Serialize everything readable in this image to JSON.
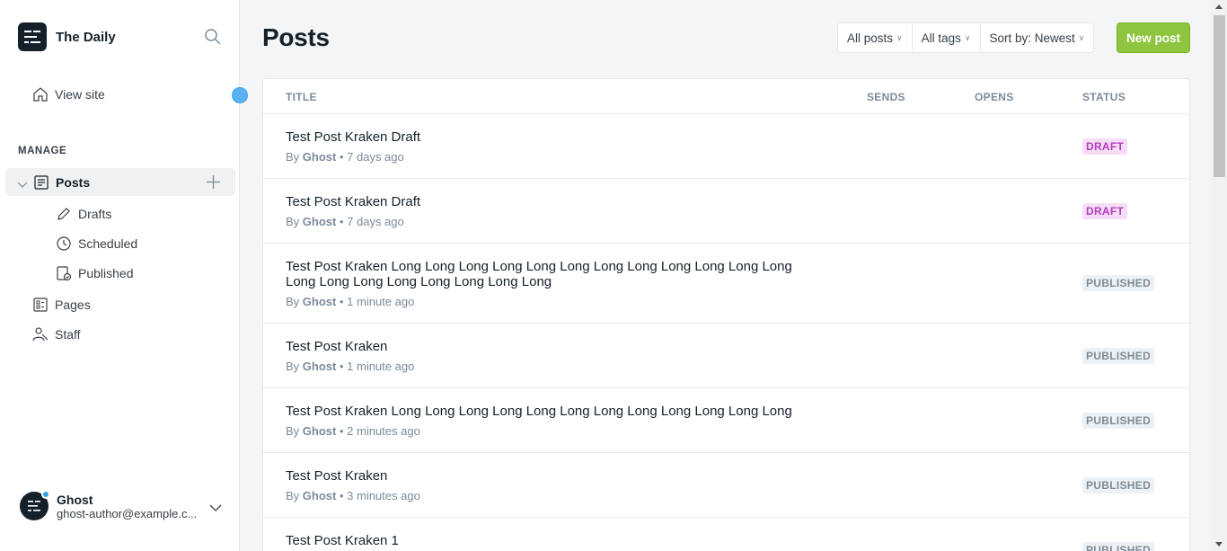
{
  "brand": {
    "name": "The Daily"
  },
  "sidebar": {
    "view_site": "View site",
    "manage_label": "MANAGE",
    "posts": "Posts",
    "sub_items": [
      "Drafts",
      "Scheduled",
      "Published"
    ],
    "pages": "Pages",
    "staff": "Staff"
  },
  "user": {
    "name": "Ghost",
    "email": "ghost-author@example.c..."
  },
  "header": {
    "title": "Posts",
    "filters": [
      "All posts",
      "All tags",
      "Sort by: Newest"
    ],
    "new_post": "New post"
  },
  "table": {
    "columns": [
      "TITLE",
      "SENDS",
      "OPENS",
      "STATUS"
    ],
    "rows": [
      {
        "title": "Test Post Kraken Draft",
        "by": "By",
        "author": "Ghost",
        "time": "• 7 days ago",
        "status": "DRAFT"
      },
      {
        "title": "Test Post Kraken Draft",
        "by": "By",
        "author": "Ghost",
        "time": "• 7 days ago",
        "status": "DRAFT"
      },
      {
        "title": "Test Post Kraken Long Long Long Long Long Long Long Long Long Long Long Long Long Long Long Long Long Long Long Long",
        "by": "By",
        "author": "Ghost",
        "time": "• 1 minute ago",
        "status": "PUBLISHED"
      },
      {
        "title": "Test Post Kraken",
        "by": "By",
        "author": "Ghost",
        "time": "• 1 minute ago",
        "status": "PUBLISHED"
      },
      {
        "title": "Test Post Kraken Long Long Long Long Long Long Long Long Long Long Long Long",
        "by": "By",
        "author": "Ghost",
        "time": "• 2 minutes ago",
        "status": "PUBLISHED"
      },
      {
        "title": "Test Post Kraken",
        "by": "By",
        "author": "Ghost",
        "time": "• 3 minutes ago",
        "status": "PUBLISHED"
      },
      {
        "title": "Test Post Kraken 1",
        "by": "",
        "author": "",
        "time": "",
        "status": "PUBLISHED"
      }
    ]
  },
  "colors": {
    "accent": "#8fc43f",
    "draft": "#b43dbd",
    "published": "#7c8b9a"
  }
}
